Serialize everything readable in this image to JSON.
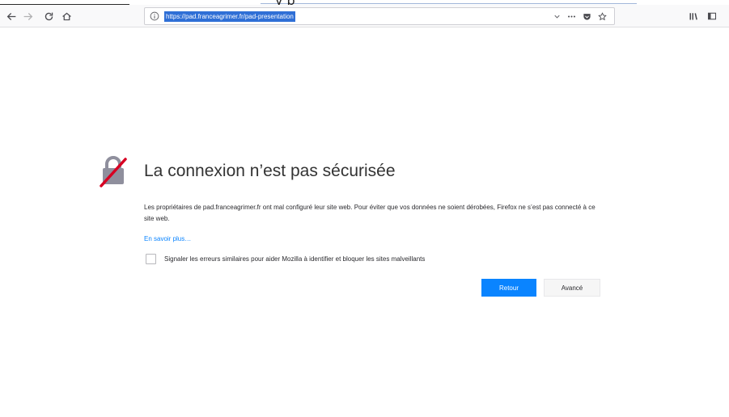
{
  "top_fragment": "y p",
  "toolbar": {
    "back_icon": "arrow-left-icon",
    "forward_icon": "arrow-right-icon",
    "reload_icon": "reload-icon",
    "home_icon": "home-icon",
    "url": "https://pad.franceagrimer.fr/pad-presentation",
    "dropdown_icon": "chevron-down-icon",
    "page_actions_icon": "ellipsis-icon",
    "pocket_icon": "pocket-icon",
    "bookmark_icon": "star-icon",
    "library_icon": "library-icon",
    "sidebar_icon": "sidebar-icon"
  },
  "error": {
    "icon": "broken-lock-icon",
    "title": "La connexion n’est pas sécurisée",
    "description": "Les propriétaires de pad.franceagrimer.fr ont mal configuré leur site web. Pour éviter que vos données ne soient dérobées, Firefox ne s’est pas connecté à ce site web.",
    "learn_more": "En savoir plus…",
    "report_label": "Signaler les erreurs similaires pour aider Mozilla à identifier et bloquer les sites malveillants",
    "report_checked": false,
    "go_back_label": "Retour",
    "advanced_label": "Avancé"
  },
  "colors": {
    "accent": "#0a84ff",
    "url_highlight": "#2f6fd6",
    "icon_red": "#d70022"
  }
}
